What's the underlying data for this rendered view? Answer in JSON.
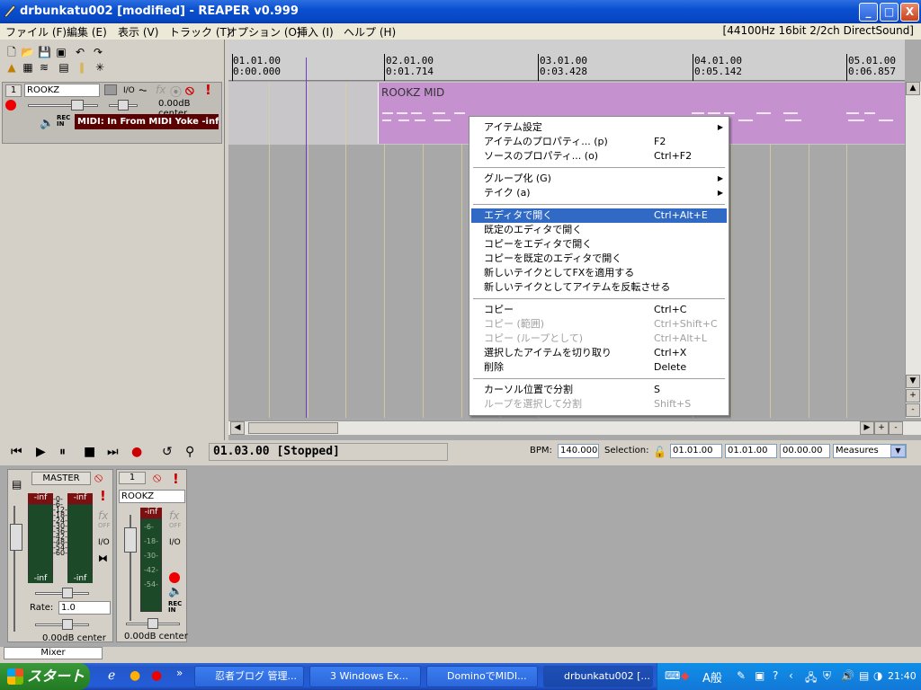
{
  "window": {
    "title": "drbunkatu002 [modified] - REAPER v0.999",
    "buttons": [
      "_",
      "□",
      "X"
    ]
  },
  "menubar": {
    "items": [
      "ファイル (F)",
      "編集 (E)",
      "表示 (V)",
      "トラック (T)",
      "オプション (O)",
      "挿入 (I)",
      "ヘルプ (H)"
    ],
    "status": "[44100Hz 16bit 2/2ch DirectSound]"
  },
  "track": {
    "number": "1",
    "name": "ROOKZ",
    "io": "I/O",
    "fx": "fx",
    "volume": "0.00dB center",
    "rec": "REC IN",
    "input": "MIDI: In From MIDI Yoke -inf"
  },
  "ruler": {
    "marks": [
      {
        "measure": "01.01.00",
        "time": "0:00.000"
      },
      {
        "measure": "02.01.00",
        "time": "0:01.714"
      },
      {
        "measure": "03.01.00",
        "time": "0:03.428"
      },
      {
        "measure": "04.01.00",
        "time": "0:05.142"
      },
      {
        "measure": "05.01.00",
        "time": "0:06.857"
      }
    ]
  },
  "item": {
    "label": "ROOKZ MID"
  },
  "context_menu": {
    "items": [
      {
        "label": "アイテム設定",
        "shortcut": "",
        "submenu": true
      },
      {
        "label": "アイテムのプロパティ... (p)",
        "shortcut": "F2"
      },
      {
        "label": "ソースのプロパティ... (o)",
        "shortcut": "Ctrl+F2"
      },
      {
        "sep": true
      },
      {
        "label": "グループ化 (G)",
        "shortcut": "",
        "submenu": true
      },
      {
        "label": "テイク (a)",
        "shortcut": "",
        "submenu": true
      },
      {
        "sep": true
      },
      {
        "label": "エディタで開く",
        "shortcut": "Ctrl+Alt+E",
        "highlight": true
      },
      {
        "label": "既定のエディタで開く",
        "shortcut": ""
      },
      {
        "label": "コピーをエディタで開く",
        "shortcut": ""
      },
      {
        "label": "コピーを既定のエディタで開く",
        "shortcut": ""
      },
      {
        "label": "新しいテイクとしてFXを適用する",
        "shortcut": ""
      },
      {
        "label": "新しいテイクとしてアイテムを反転させる",
        "shortcut": ""
      },
      {
        "sep": true
      },
      {
        "label": "コピー",
        "shortcut": "Ctrl+C"
      },
      {
        "label": "コピー (範囲)",
        "shortcut": "Ctrl+Shift+C",
        "disabled": true
      },
      {
        "label": "コピー (ループとして)",
        "shortcut": "Ctrl+Alt+L",
        "disabled": true
      },
      {
        "label": "選択したアイテムを切り取り",
        "shortcut": "Ctrl+X"
      },
      {
        "label": "削除",
        "shortcut": "Delete"
      },
      {
        "sep": true
      },
      {
        "label": "カーソル位置で分割",
        "shortcut": "S"
      },
      {
        "label": "ループを選択して分割",
        "shortcut": "Shift+S",
        "disabled": true
      }
    ]
  },
  "transport": {
    "status": "01.03.00 [Stopped]",
    "bpm_label": "BPM:",
    "bpm": "140.000",
    "selection_label": "Selection:",
    "sel_start": "01.01.00",
    "sel_end": "01.01.00",
    "sel_len": "00.00.00",
    "units": "Measures"
  },
  "mixer": {
    "master_label": "MASTER",
    "master_meter_left": "-inf",
    "master_meter_right": "-inf",
    "master_bottom_left": "-inf",
    "master_bottom_right": "-inf",
    "master_scale": "-0-\n-6-\n-12-\n-18-\n-24-\n-30-\n-36-\n-42-\n-48-\n-54-\n-60-",
    "rate_label": "Rate:",
    "rate": "1.0",
    "master_vol": "0.00dB center",
    "fx": "fx",
    "fx_state": "OFF",
    "io": "I/O",
    "track_number": "1",
    "track_name": "ROOKZ",
    "track_meter": "-inf",
    "track_scale": "-6-\n\n-18-\n\n-30-\n\n-42-\n\n-54-",
    "track_vol": "0.00dB center",
    "rec": "REC IN",
    "tab": "Mixer"
  },
  "taskbar": {
    "start": "スタート",
    "tasks": [
      "忍者ブログ 管理...",
      "3 Windows Ex...",
      "DominoでMIDI...",
      "drbunkatu002 [..."
    ],
    "ime": "A般",
    "clock": "21:40"
  }
}
